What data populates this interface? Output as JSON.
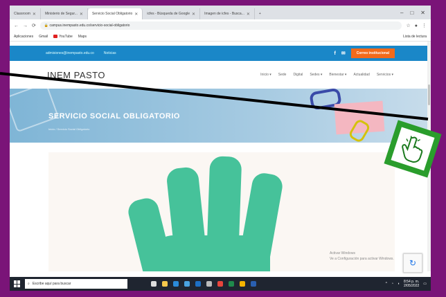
{
  "browser": {
    "tabs": [
      {
        "label": "Classroom",
        "active": false
      },
      {
        "label": "Ministerio de Segur...",
        "active": false
      },
      {
        "label": "Servicio Social Obligatorio",
        "active": true
      },
      {
        "label": "icfes - Búsqueda de Google",
        "active": false
      },
      {
        "label": "Imagen de icfes - Busca...",
        "active": false
      }
    ],
    "url": "campus.inempasto.edu.co/servicio-social-obligatorio",
    "bookmarks": [
      "Aplicaciones",
      "Gmail",
      "YouTube",
      "Maps"
    ],
    "bookmarks_right": "Lista de lectura"
  },
  "site": {
    "topbar_email": "admisiones@inempasto.edu.co",
    "topbar_link": "Noticias",
    "cta": "Correo institucional",
    "logo": "INEM PASTO",
    "menu": [
      "Inicio ▾",
      "Sede",
      "Digital",
      "Sedes ▾",
      "Bienestar ▾",
      "Actualidad",
      "Servicios ▾"
    ],
    "banner_title": "SERVICIO SOCIAL OBLIGATORIO",
    "breadcrumb": "Inicio / Servicio Social Obligatorio",
    "recaptcha_title": "Activar Windows",
    "recaptcha_sub": "Ve a Configuración para activar Windows."
  },
  "taskbar": {
    "search_placeholder": "Escribe aquí para buscar",
    "time": "8:54 p. m.",
    "date": "2/05/2022"
  },
  "icons": [
    "search-icon",
    "windows-start-icon",
    "hand-pointer-icon",
    "recaptcha-icon"
  ],
  "colors": {
    "frame": "#7a1478",
    "topbar": "#1a87c8",
    "cta": "#f26a1b",
    "hand": "#46c29a",
    "pointer_box": "#2a9d2c"
  }
}
